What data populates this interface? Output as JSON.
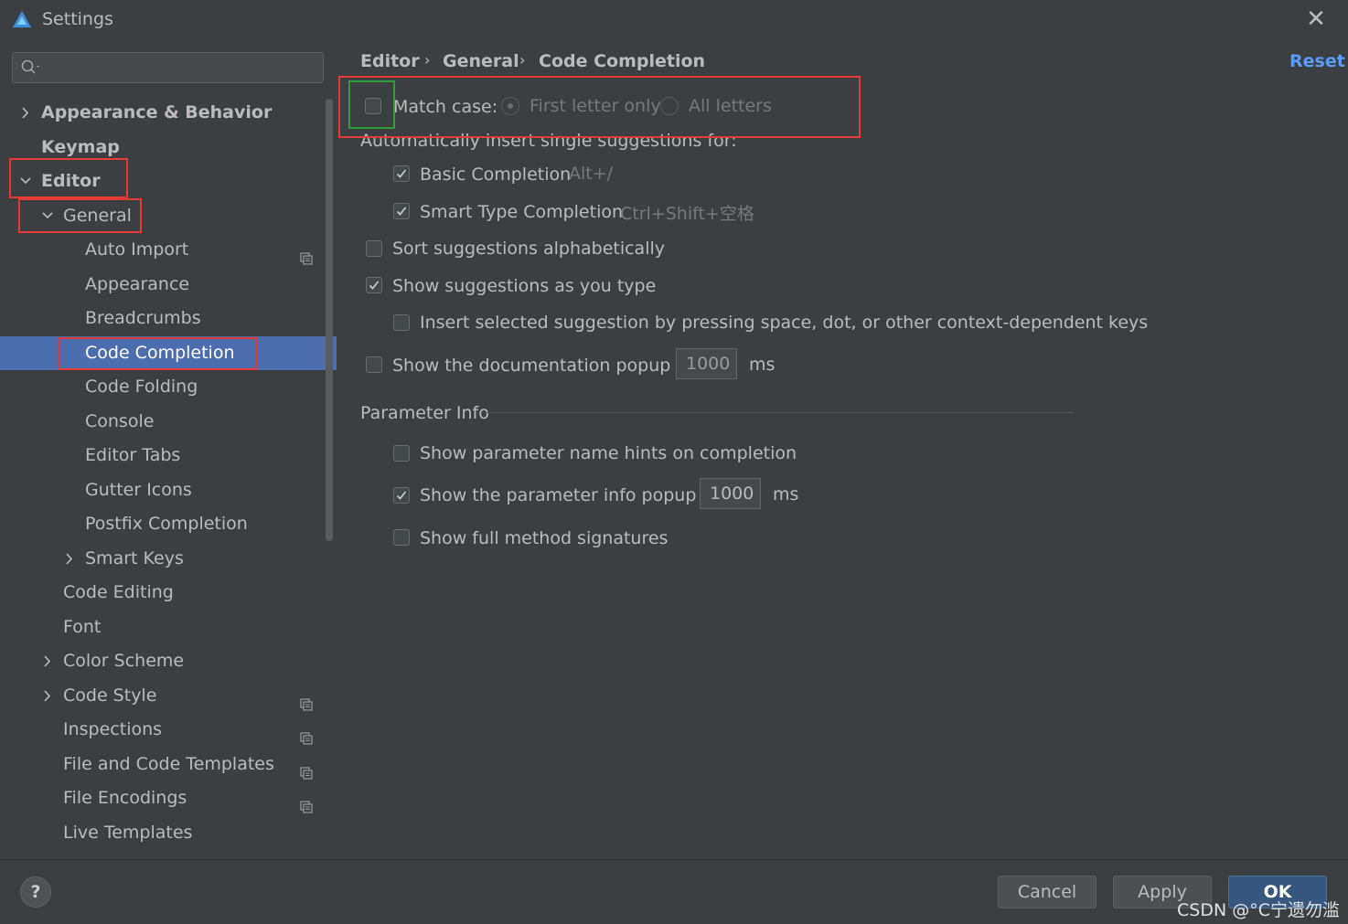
{
  "window": {
    "title": "Settings"
  },
  "search": {
    "placeholder": ""
  },
  "tree": [
    {
      "label": "Appearance & Behavior",
      "bold": true,
      "chevron": "right",
      "indent": 0
    },
    {
      "label": "Keymap",
      "bold": true,
      "chevron": "",
      "indent": 0
    },
    {
      "label": "Editor",
      "bold": true,
      "chevron": "down",
      "indent": 0
    },
    {
      "label": "General",
      "bold": false,
      "chevron": "down",
      "indent": 1
    },
    {
      "label": "Auto Import",
      "bold": false,
      "chevron": "",
      "indent": 2,
      "project": true
    },
    {
      "label": "Appearance",
      "bold": false,
      "chevron": "",
      "indent": 2
    },
    {
      "label": "Breadcrumbs",
      "bold": false,
      "chevron": "",
      "indent": 2
    },
    {
      "label": "Code Completion",
      "bold": false,
      "chevron": "",
      "indent": 2,
      "selected": true
    },
    {
      "label": "Code Folding",
      "bold": false,
      "chevron": "",
      "indent": 2
    },
    {
      "label": "Console",
      "bold": false,
      "chevron": "",
      "indent": 2
    },
    {
      "label": "Editor Tabs",
      "bold": false,
      "chevron": "",
      "indent": 2
    },
    {
      "label": "Gutter Icons",
      "bold": false,
      "chevron": "",
      "indent": 2
    },
    {
      "label": "Postfix Completion",
      "bold": false,
      "chevron": "",
      "indent": 2
    },
    {
      "label": "Smart Keys",
      "bold": false,
      "chevron": "right",
      "indent": 2
    },
    {
      "label": "Code Editing",
      "bold": false,
      "chevron": "",
      "indent": 1
    },
    {
      "label": "Font",
      "bold": false,
      "chevron": "",
      "indent": 1
    },
    {
      "label": "Color Scheme",
      "bold": false,
      "chevron": "right",
      "indent": 1
    },
    {
      "label": "Code Style",
      "bold": false,
      "chevron": "right",
      "indent": 1,
      "project": true
    },
    {
      "label": "Inspections",
      "bold": false,
      "chevron": "",
      "indent": 1,
      "project": true
    },
    {
      "label": "File and Code Templates",
      "bold": false,
      "chevron": "",
      "indent": 1,
      "project": true
    },
    {
      "label": "File Encodings",
      "bold": false,
      "chevron": "",
      "indent": 1,
      "project": true
    },
    {
      "label": "Live Templates",
      "bold": false,
      "chevron": "",
      "indent": 1
    }
  ],
  "breadcrumb": {
    "items": [
      "Editor",
      "General",
      "Code Completion"
    ],
    "separator": "›",
    "reset": "Reset"
  },
  "match_case": {
    "label": "Match case:",
    "checked": false,
    "options": [
      {
        "label": "First letter only",
        "selected": true
      },
      {
        "label": "All letters",
        "selected": false
      }
    ]
  },
  "auto_insert": {
    "heading": "Automatically insert single suggestions for:",
    "basic": {
      "label": "Basic Completion",
      "shortcut": "Alt+/",
      "checked": true
    },
    "smart": {
      "label": "Smart Type Completion",
      "shortcut": "Ctrl+Shift+空格",
      "checked": true
    }
  },
  "sort_alpha": {
    "label": "Sort suggestions alphabetically",
    "checked": false
  },
  "show_as_type": {
    "label": "Show suggestions as you type",
    "checked": true
  },
  "insert_selected": {
    "label": "Insert selected suggestion by pressing space, dot, or other context-dependent keys",
    "checked": false
  },
  "doc_popup": {
    "label": "Show the documentation popup in",
    "value": "1000",
    "unit": "ms",
    "checked": false
  },
  "param_info": {
    "heading": "Parameter Info",
    "name_hints": {
      "label": "Show parameter name hints on completion",
      "checked": false
    },
    "info_popup": {
      "label": "Show the parameter info popup in",
      "value": "1000",
      "unit": "ms",
      "checked": true
    },
    "full_sig": {
      "label": "Show full method signatures",
      "checked": false
    }
  },
  "footer": {
    "help": "?",
    "cancel": "Cancel",
    "apply": "Apply",
    "ok": "OK",
    "watermark": "CSDN @°C宁遗勿滥"
  },
  "colors": {
    "accent": "#4b6eaf",
    "link": "#589df6",
    "annotation_red": "#e53935",
    "annotation_green": "#2e9c3a"
  }
}
